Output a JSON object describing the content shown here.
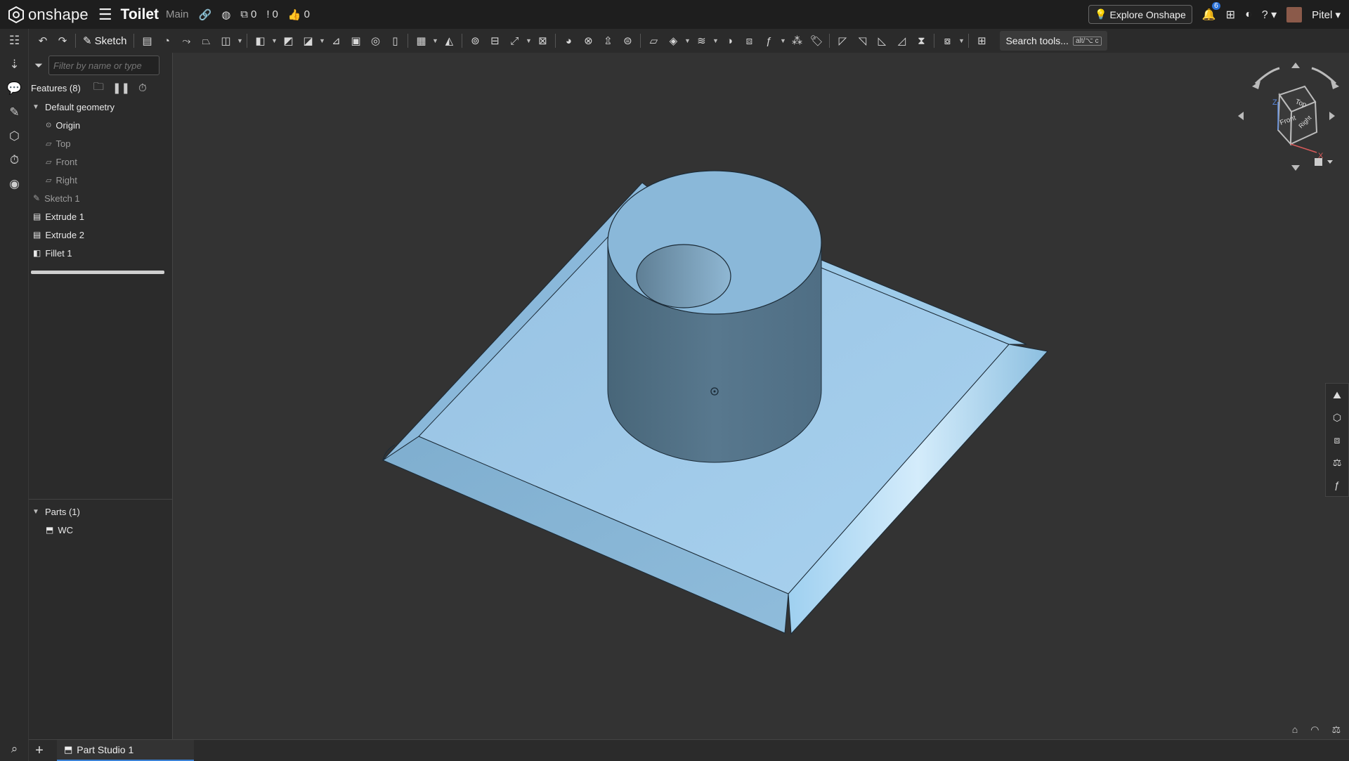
{
  "topbar": {
    "app_name": "onshape",
    "doc_title": "Toilet",
    "branch": "Main",
    "versions_count": "0",
    "tasks_count": "0",
    "likes_count": "0",
    "explore_label": "Explore Onshape",
    "notifications_count": "6",
    "user_name": "Pitel"
  },
  "toolbar": {
    "sketch_label": "Sketch",
    "search_label": "Search tools...",
    "search_shortcut": "alt/⌥ c"
  },
  "panel": {
    "filter_placeholder": "Filter by name or type",
    "features_header": "Features (8)",
    "default_geometry": "Default geometry",
    "origin": "Origin",
    "planes": [
      "Top",
      "Front",
      "Right"
    ],
    "features": [
      "Sketch 1",
      "Extrude 1",
      "Extrude 2",
      "Fillet 1"
    ],
    "parts_header": "Parts (1)",
    "parts": [
      "WC"
    ]
  },
  "viewcube": {
    "top": "Top",
    "front": "Front",
    "right": "Right",
    "axis_z": "Z",
    "axis_x": "X"
  },
  "tabs": {
    "part_studio": "Part Studio 1"
  },
  "colors": {
    "model_face": "#8fbbdf",
    "model_shade": "#4f6f86",
    "background": "#333333",
    "accent": "#3b82d6"
  }
}
